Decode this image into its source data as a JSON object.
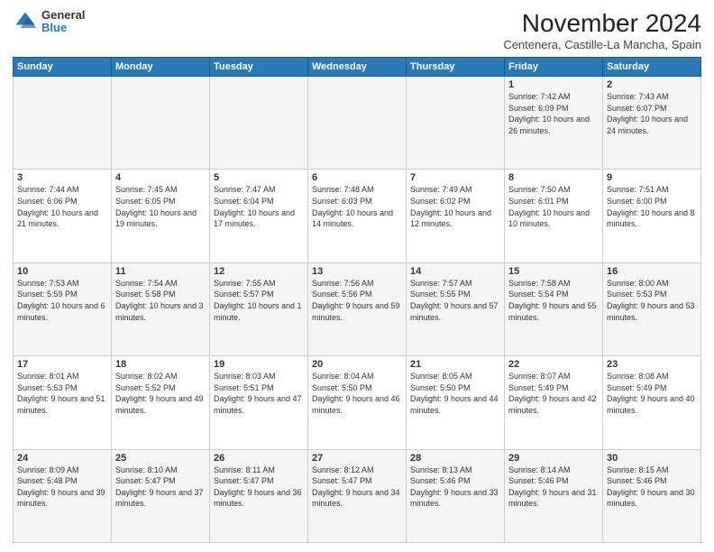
{
  "header": {
    "logo_general": "General",
    "logo_blue": "Blue",
    "month_title": "November 2024",
    "location": "Centenera, Castille-La Mancha, Spain"
  },
  "weekdays": [
    "Sunday",
    "Monday",
    "Tuesday",
    "Wednesday",
    "Thursday",
    "Friday",
    "Saturday"
  ],
  "weeks": [
    [
      {
        "day": "",
        "info": ""
      },
      {
        "day": "",
        "info": ""
      },
      {
        "day": "",
        "info": ""
      },
      {
        "day": "",
        "info": ""
      },
      {
        "day": "",
        "info": ""
      },
      {
        "day": "1",
        "info": "Sunrise: 7:42 AM\nSunset: 6:09 PM\nDaylight: 10 hours and 26 minutes."
      },
      {
        "day": "2",
        "info": "Sunrise: 7:43 AM\nSunset: 6:07 PM\nDaylight: 10 hours and 24 minutes."
      }
    ],
    [
      {
        "day": "3",
        "info": "Sunrise: 7:44 AM\nSunset: 6:06 PM\nDaylight: 10 hours and 21 minutes."
      },
      {
        "day": "4",
        "info": "Sunrise: 7:45 AM\nSunset: 6:05 PM\nDaylight: 10 hours and 19 minutes."
      },
      {
        "day": "5",
        "info": "Sunrise: 7:47 AM\nSunset: 6:04 PM\nDaylight: 10 hours and 17 minutes."
      },
      {
        "day": "6",
        "info": "Sunrise: 7:48 AM\nSunset: 6:03 PM\nDaylight: 10 hours and 14 minutes."
      },
      {
        "day": "7",
        "info": "Sunrise: 7:49 AM\nSunset: 6:02 PM\nDaylight: 10 hours and 12 minutes."
      },
      {
        "day": "8",
        "info": "Sunrise: 7:50 AM\nSunset: 6:01 PM\nDaylight: 10 hours and 10 minutes."
      },
      {
        "day": "9",
        "info": "Sunrise: 7:51 AM\nSunset: 6:00 PM\nDaylight: 10 hours and 8 minutes."
      }
    ],
    [
      {
        "day": "10",
        "info": "Sunrise: 7:53 AM\nSunset: 5:59 PM\nDaylight: 10 hours and 6 minutes."
      },
      {
        "day": "11",
        "info": "Sunrise: 7:54 AM\nSunset: 5:58 PM\nDaylight: 10 hours and 3 minutes."
      },
      {
        "day": "12",
        "info": "Sunrise: 7:55 AM\nSunset: 5:57 PM\nDaylight: 10 hours and 1 minute."
      },
      {
        "day": "13",
        "info": "Sunrise: 7:56 AM\nSunset: 5:56 PM\nDaylight: 9 hours and 59 minutes."
      },
      {
        "day": "14",
        "info": "Sunrise: 7:57 AM\nSunset: 5:55 PM\nDaylight: 9 hours and 57 minutes."
      },
      {
        "day": "15",
        "info": "Sunrise: 7:58 AM\nSunset: 5:54 PM\nDaylight: 9 hours and 55 minutes."
      },
      {
        "day": "16",
        "info": "Sunrise: 8:00 AM\nSunset: 5:53 PM\nDaylight: 9 hours and 53 minutes."
      }
    ],
    [
      {
        "day": "17",
        "info": "Sunrise: 8:01 AM\nSunset: 5:53 PM\nDaylight: 9 hours and 51 minutes."
      },
      {
        "day": "18",
        "info": "Sunrise: 8:02 AM\nSunset: 5:52 PM\nDaylight: 9 hours and 49 minutes."
      },
      {
        "day": "19",
        "info": "Sunrise: 8:03 AM\nSunset: 5:51 PM\nDaylight: 9 hours and 47 minutes."
      },
      {
        "day": "20",
        "info": "Sunrise: 8:04 AM\nSunset: 5:50 PM\nDaylight: 9 hours and 46 minutes."
      },
      {
        "day": "21",
        "info": "Sunrise: 8:05 AM\nSunset: 5:50 PM\nDaylight: 9 hours and 44 minutes."
      },
      {
        "day": "22",
        "info": "Sunrise: 8:07 AM\nSunset: 5:49 PM\nDaylight: 9 hours and 42 minutes."
      },
      {
        "day": "23",
        "info": "Sunrise: 8:08 AM\nSunset: 5:49 PM\nDaylight: 9 hours and 40 minutes."
      }
    ],
    [
      {
        "day": "24",
        "info": "Sunrise: 8:09 AM\nSunset: 5:48 PM\nDaylight: 9 hours and 39 minutes."
      },
      {
        "day": "25",
        "info": "Sunrise: 8:10 AM\nSunset: 5:47 PM\nDaylight: 9 hours and 37 minutes."
      },
      {
        "day": "26",
        "info": "Sunrise: 8:11 AM\nSunset: 5:47 PM\nDaylight: 9 hours and 36 minutes."
      },
      {
        "day": "27",
        "info": "Sunrise: 8:12 AM\nSunset: 5:47 PM\nDaylight: 9 hours and 34 minutes."
      },
      {
        "day": "28",
        "info": "Sunrise: 8:13 AM\nSunset: 5:46 PM\nDaylight: 9 hours and 33 minutes."
      },
      {
        "day": "29",
        "info": "Sunrise: 8:14 AM\nSunset: 5:46 PM\nDaylight: 9 hours and 31 minutes."
      },
      {
        "day": "30",
        "info": "Sunrise: 8:15 AM\nSunset: 5:46 PM\nDaylight: 9 hours and 30 minutes."
      }
    ]
  ]
}
